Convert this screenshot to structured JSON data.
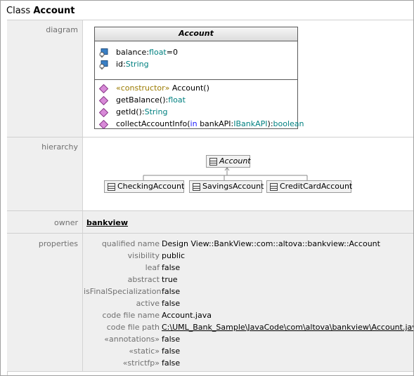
{
  "title": {
    "prefix": "Class",
    "name": "Account"
  },
  "labels": {
    "diagram": "diagram",
    "hierarchy": "hierarchy",
    "owner": "owner",
    "properties": "properties"
  },
  "uml": {
    "class_name": "Account",
    "attributes": [
      {
        "name": "balance",
        "sep": ":",
        "type": "float",
        "default": "=0"
      },
      {
        "name": "id",
        "sep": ":",
        "type": "String"
      }
    ],
    "operations": [
      {
        "stereotype": "«constructor»",
        "name": " Account()"
      },
      {
        "name": "getBalance()",
        "sep": ":",
        "type": "float"
      },
      {
        "name": "getId()",
        "sep": ":",
        "type": "String"
      },
      {
        "name": "collectAccountInfo(",
        "kw": "in",
        "param": " bankAPI:",
        "ptype": "IBankAPI",
        "close": "):",
        "type": "boolean"
      }
    ]
  },
  "hierarchy": {
    "parent": "Account",
    "children": [
      "CheckingAccount",
      "SavingsAccount",
      "CreditCardAccount"
    ]
  },
  "owner": "bankview",
  "properties": [
    {
      "key": "qualified name",
      "value": "Design View::BankView::com::altova::bankview::Account"
    },
    {
      "key": "visibility",
      "value": "public"
    },
    {
      "key": "leaf",
      "value": "false"
    },
    {
      "key": "abstract",
      "value": "true"
    },
    {
      "key": "isFinalSpecialization",
      "value": "false"
    },
    {
      "key": "active",
      "value": "false"
    },
    {
      "key": "code file name",
      "value": "Account.java"
    },
    {
      "key": "code file path",
      "value": "C:\\UML_Bank_Sample\\JavaCode\\com\\altova\\bankview\\Account.java"
    },
    {
      "key": "«annotations»",
      "value": "false"
    },
    {
      "key": "«static»",
      "value": "false"
    },
    {
      "key": "«strictfp»",
      "value": "false"
    }
  ]
}
